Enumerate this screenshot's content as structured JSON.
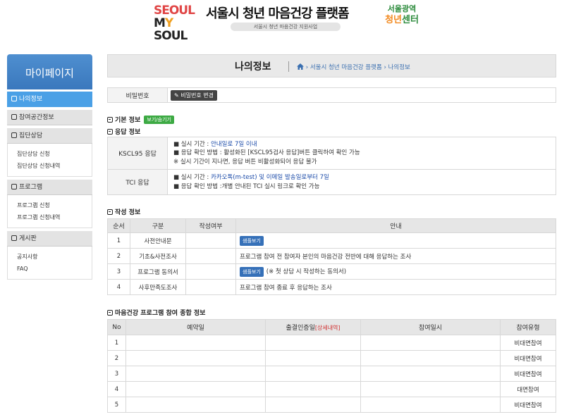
{
  "header": {
    "logo_line1": "SEOUL",
    "logo_line2_a": "M",
    "logo_line2_b": "Y",
    "logo_line2_c": " SOUL",
    "title": "서울시 청년 마음건강 플랫폼",
    "subtitle": "서울시 청년 마음건강 지원사업",
    "center_logo_line1": "서울광역",
    "center_logo_line2_a": "청년",
    "center_logo_line2_b": "센터"
  },
  "sidebar": {
    "title": "마이페이지",
    "sections": [
      {
        "label": "나의정보",
        "active": true,
        "links": []
      },
      {
        "label": "참여공간정보",
        "active": false,
        "links": []
      },
      {
        "label": "집단상담",
        "active": false,
        "links": [
          "집단상담 신청",
          "집단상담 신청내역"
        ]
      },
      {
        "label": "프로그램",
        "active": false,
        "links": [
          "프로그램 신청",
          "프로그램 신청내역"
        ]
      },
      {
        "label": "게시판",
        "active": false,
        "links": [
          "공지사항",
          "FAQ"
        ]
      }
    ]
  },
  "page": {
    "title": "나의정보",
    "breadcrumb": [
      "서울시 청년 마음건강 플랫폼",
      "나의정보"
    ]
  },
  "password": {
    "label": "비밀번호",
    "button": "비밀번호 변경"
  },
  "basic_info": {
    "title": "기본 정보",
    "toggle_button": "보기/숨기기"
  },
  "response_info": {
    "title": "응답 정보",
    "rows": [
      {
        "label": "KSCL95 응답",
        "period_prefix": "■ 실시 기간 : ",
        "period_value": "안내일로 7일 이내",
        "method": "■ 응답 확인 방법 : 활성화된 [KSCL95검사 응답]버튼 클릭하여 확인 가능",
        "note": "※ 실시 기간이 지나면, 응답 버튼 비활성화되어 응답 불가"
      },
      {
        "label": "TCI 응답",
        "period_prefix": "■ 실시 기간 : ",
        "period_value": "카카오톡(m-test) 및 이메일 발송일로부터 7일",
        "method": "■ 응답 확인 방법 :개별 안내된 TCI 실시 링크로 확인 가능",
        "note": ""
      }
    ]
  },
  "write_info": {
    "title": "작성 정보",
    "headers": [
      "순서",
      "구분",
      "작성여부",
      "안내"
    ],
    "sample_button": "샘플보기",
    "rows": [
      {
        "no": "1",
        "type": "사전안내문",
        "status": "",
        "has_sample": true,
        "guide": ""
      },
      {
        "no": "2",
        "type": "기초&사전조사",
        "status": "",
        "has_sample": false,
        "guide": "프로그램 참여 전 참여자 본인의 마음건강 전반에 대해 응답하는 조사"
      },
      {
        "no": "3",
        "type": "프로그램 동의서",
        "status": "",
        "has_sample": true,
        "guide": "(※ 첫 상담 시 작성하는 동의서)"
      },
      {
        "no": "4",
        "type": "사후만족도조사",
        "status": "",
        "has_sample": false,
        "guide": "프로그램 참여 종료 후 응답하는 조사"
      }
    ]
  },
  "participation": {
    "title": "마음건강 프로그램 참여 종합 정보",
    "headers": {
      "no": "No",
      "reserve": "예약일",
      "checkin": "출결인증일",
      "checkin_detail": "[상세내역]",
      "date": "참여일시",
      "type": "참여유형"
    },
    "rows": [
      {
        "no": "1",
        "type": "비대면참여"
      },
      {
        "no": "2",
        "type": "비대면참여"
      },
      {
        "no": "3",
        "type": "비대면참여"
      },
      {
        "no": "4",
        "type": "대면참여"
      },
      {
        "no": "5",
        "type": "비대면참여"
      }
    ]
  },
  "colors": {
    "accent": "#4aa0e6",
    "sidebar_head": "#3a78bd",
    "link": "#1a4aa8",
    "green": "#3daa44",
    "sample": "#3570b8"
  }
}
